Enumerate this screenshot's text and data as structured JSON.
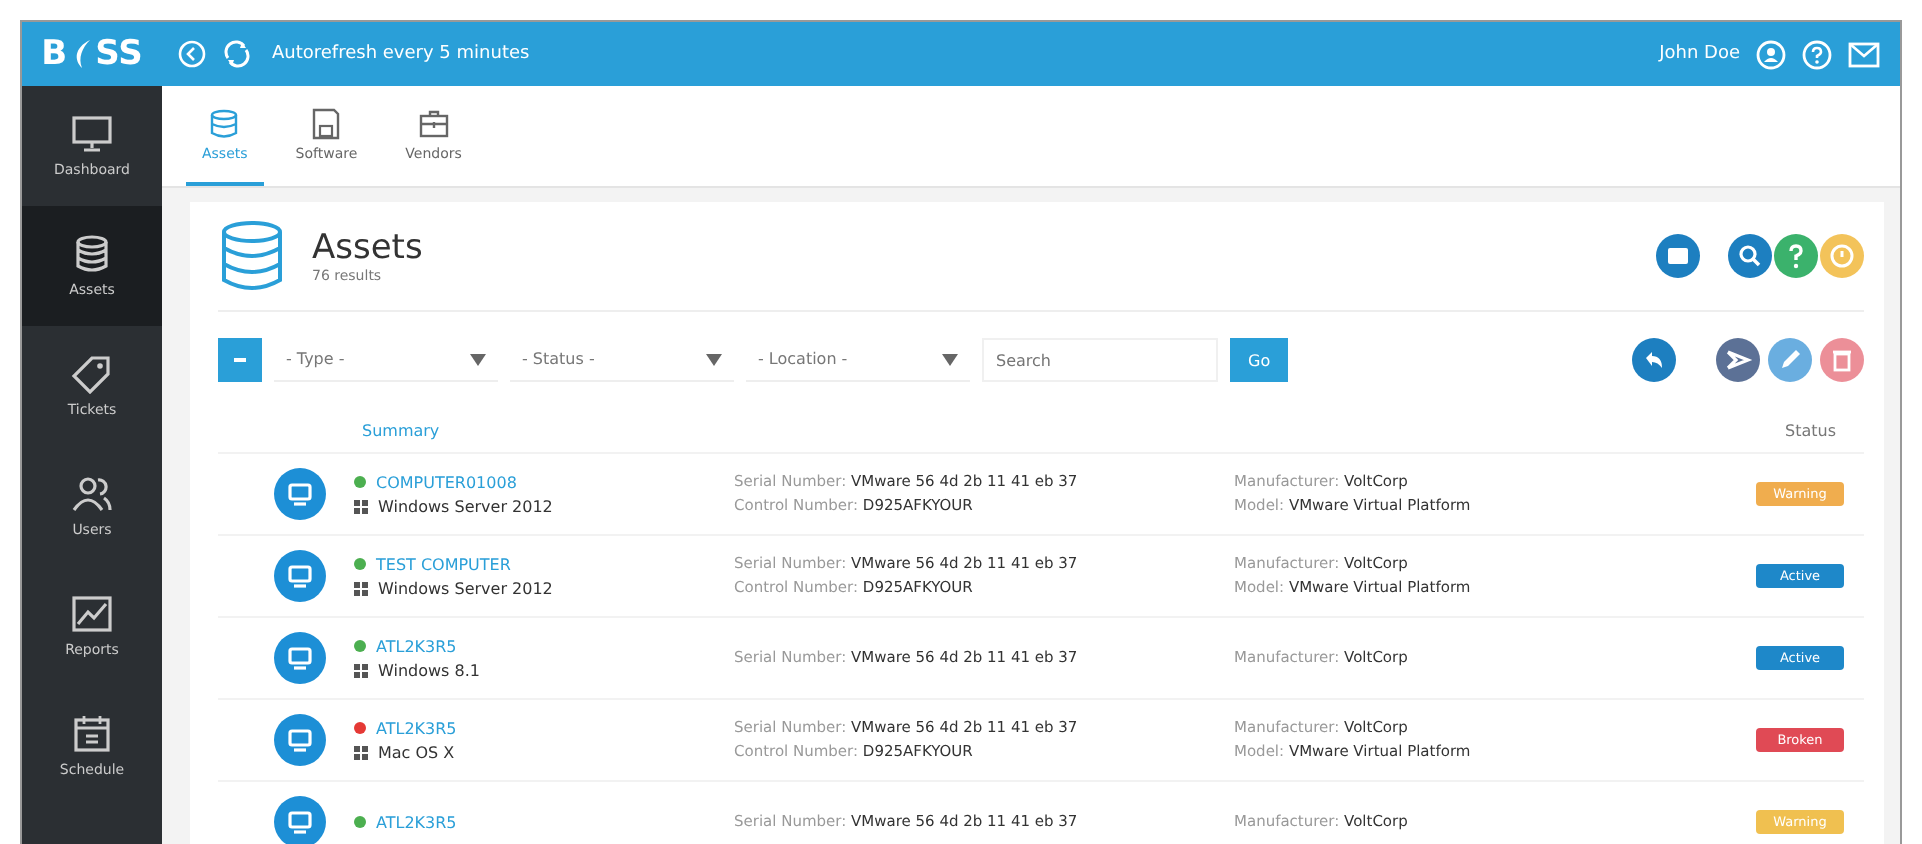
{
  "header": {
    "logo_left": "B",
    "logo_right": "SS",
    "autorefresh": "Autorefresh every 5 minutes",
    "user": "John Doe"
  },
  "sidebar": {
    "items": [
      {
        "label": "Dashboard",
        "selected": false
      },
      {
        "label": "Assets",
        "selected": true
      },
      {
        "label": "Tickets",
        "selected": false
      },
      {
        "label": "Users",
        "selected": false
      },
      {
        "label": "Reports",
        "selected": false
      },
      {
        "label": "Schedule",
        "selected": false
      }
    ]
  },
  "tabs": [
    {
      "label": "Assets",
      "selected": true
    },
    {
      "label": "Software",
      "selected": false
    },
    {
      "label": "Vendors",
      "selected": false
    }
  ],
  "card": {
    "title": "Assets",
    "subtitle": "76 results"
  },
  "filters": {
    "selects": [
      "- Type -",
      "- Status -",
      "- Location -"
    ],
    "search": {
      "placeholder": "Search"
    },
    "button": "Go"
  },
  "table": {
    "columns": [
      "Summary",
      "Status"
    ],
    "rows": [
      {
        "name": "COMPUTER01008",
        "color": "#4caf50",
        "os": "Windows Server 2012",
        "serial": {
          "label": "Serial Number:",
          "value": "VMware 56 4d 2b 11 41 eb 37"
        },
        "control": {
          "label": "Control Number:",
          "value": "D925AFKYOUR"
        },
        "manufacturer": {
          "label": "Manufacturer:",
          "value": "VoltCorp"
        },
        "model": {
          "label": "Model:",
          "value": "VMware Virtual Platform"
        },
        "status": {
          "text": "Warning",
          "color": "#f0ad4e"
        }
      },
      {
        "name": "TEST COMPUTER",
        "color": "#4caf50",
        "os": "Windows Server 2012",
        "serial": {
          "label": "Serial Number:",
          "value": "VMware 56 4d 2b 11 41 eb 37"
        },
        "control": {
          "label": "Control Number:",
          "value": "D925AFKYOUR"
        },
        "manufacturer": {
          "label": "Manufacturer:",
          "value": "VoltCorp"
        },
        "model": {
          "label": "Model:",
          "value": "VMware Virtual Platform"
        },
        "status": {
          "text": "Active",
          "color": "#1e88c9"
        }
      },
      {
        "name": "ATL2K3R5",
        "color": "#4caf50",
        "os": "Windows 8.1",
        "serial": {
          "label": "Serial Number:",
          "value": "VMware 56 4d 2b 11 41 eb 37"
        },
        "manufacturer": {
          "label": "Manufacturer:",
          "value": "VoltCorp"
        },
        "status": {
          "text": "Active",
          "color": "#1e88c9"
        }
      },
      {
        "name": "ATL2K3R5",
        "color": "#e53935",
        "os": "Mac OS X",
        "serial": {
          "label": "Serial Number:",
          "value": "VMware 56 4d 2b 11 41 eb 37"
        },
        "control": {
          "label": "Control Number:",
          "value": "D925AFKYOUR"
        },
        "manufacturer": {
          "label": "Manufacturer:",
          "value": "VoltCorp"
        },
        "model": {
          "label": "Model:",
          "value": "VMware Virtual Platform"
        },
        "status": {
          "text": "Broken",
          "color": "#e04a55"
        }
      },
      {
        "name": "ATL2K3R5",
        "color": "#4caf50",
        "serial": {
          "label": "Serial Number:",
          "value": "VMware 56 4d 2b 11 41 eb 37"
        },
        "manufacturer": {
          "label": "Manufacturer:",
          "value": "VoltCorp"
        },
        "status": {
          "text": "Warning",
          "color": "#f0c050"
        }
      }
    ]
  }
}
